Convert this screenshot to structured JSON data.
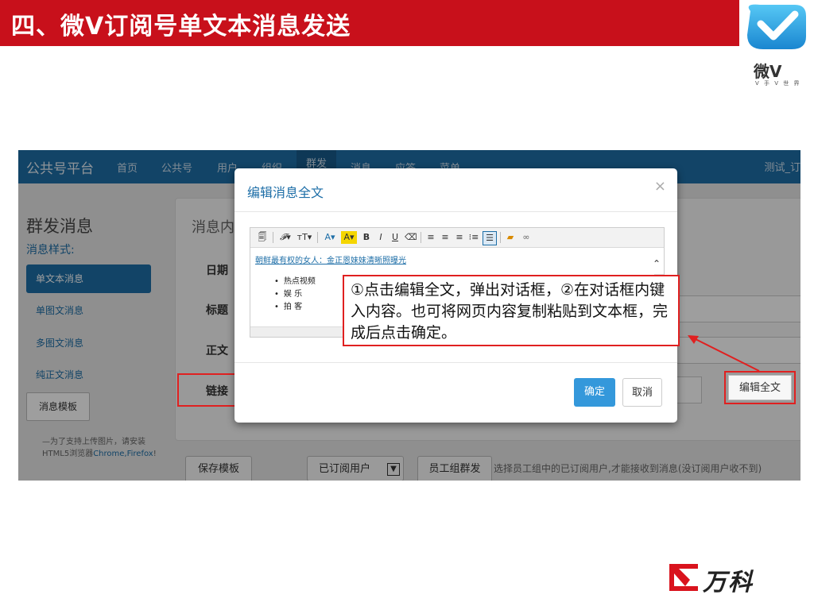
{
  "slide": {
    "title": "四、微V订阅号单文本消息发送",
    "logo_text": "微V",
    "logo_sub": "V 手 V 世 界",
    "footer_brand": "万科"
  },
  "app": {
    "brand": "公共号平台",
    "nav": [
      "首页",
      "公共号",
      "用户",
      "组织",
      "群发",
      "消息",
      "应答",
      "菜单"
    ],
    "user": "测试_订",
    "page_title": "群发消息",
    "page_subtitle": "消息样式:",
    "sidebar": [
      "单文本消息",
      "单图文消息",
      "多图文消息",
      "纯正文消息"
    ],
    "template_button": "消息模板",
    "note_text": "—为了支持上传图片，请安装HTML5浏览器",
    "note_link": "Chrome,Firefox",
    "note_tail": "!",
    "panel_heading": "消息内",
    "fields": {
      "date": "日期",
      "title": "标题",
      "body": "正文",
      "link": "链接"
    },
    "edit_full_text": "编辑全文",
    "save_template": "保存模板",
    "subscriber_select": "已订阅用户",
    "group_send": "员工组群发",
    "hint": "选择员工组中的已订阅用户,才能接收到消息(没订阅用户收不到)"
  },
  "modal": {
    "title": "编辑消息全文",
    "close": "×",
    "link_text": "朝鲜最有权的女人：金正恩妹妹清晰照曝光",
    "list_items": [
      "热点视频",
      "娱 乐",
      "拍 客"
    ],
    "ok": "确定",
    "cancel": "取消"
  },
  "callout": {
    "text": "①点击编辑全文，弹出对话框，②在对话框内键入内容。也可将网页内容复制粘贴到文本框，完成后点击确定。"
  },
  "colors": {
    "header_red": "#c8101b",
    "nav_blue": "#1d6ea7",
    "highlight_red": "#e02020",
    "ok_blue": "#3498db"
  }
}
